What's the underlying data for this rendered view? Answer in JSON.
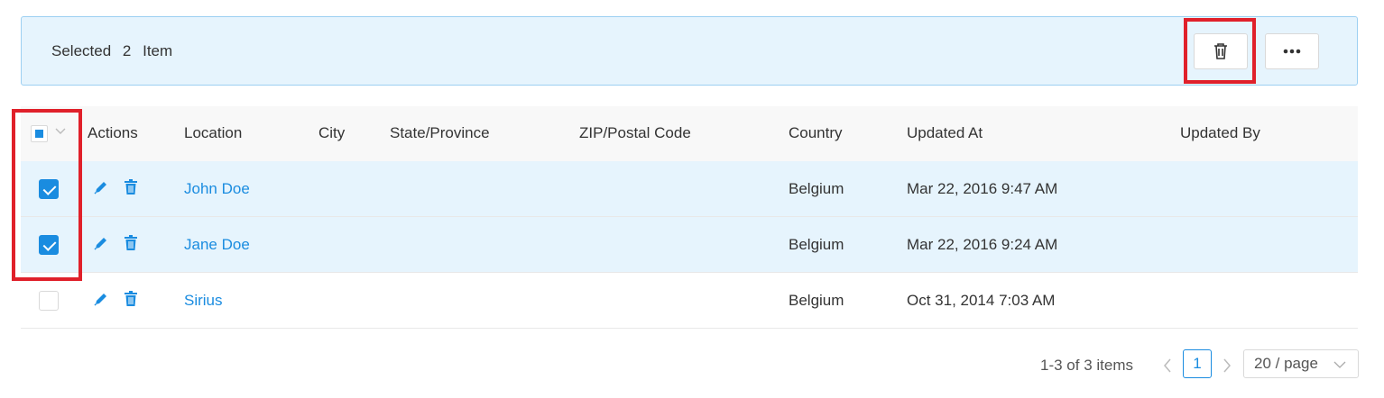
{
  "selection_bar": {
    "selected_label": "Selected",
    "selected_count": "2",
    "item_label": "Item",
    "delete_icon": "trash-icon",
    "more_icon": "ellipsis-icon"
  },
  "table": {
    "columns": [
      "Actions",
      "Location",
      "City",
      "State/Province",
      "ZIP/Postal Code",
      "Country",
      "Updated At",
      "Updated By"
    ],
    "rows": [
      {
        "selected": true,
        "location": "John Doe",
        "city": "",
        "state": "",
        "zip": "",
        "country": "Belgium",
        "updated_at": "Mar 22, 2016 9:47 AM",
        "updated_by": ""
      },
      {
        "selected": true,
        "location": "Jane Doe",
        "city": "",
        "state": "",
        "zip": "",
        "country": "Belgium",
        "updated_at": "Mar 22, 2016 9:24 AM",
        "updated_by": ""
      },
      {
        "selected": false,
        "location": "Sirius",
        "city": "",
        "state": "",
        "zip": "",
        "country": "Belgium",
        "updated_at": "Oct 31, 2014 7:03 AM",
        "updated_by": ""
      }
    ]
  },
  "pagination": {
    "summary": "1-3 of 3 items",
    "current_page": "1",
    "page_size": "20 / page"
  },
  "colors": {
    "accent": "#1a8ce0",
    "selected_row_bg": "#e6f4fd",
    "highlight": "#e0202a"
  }
}
